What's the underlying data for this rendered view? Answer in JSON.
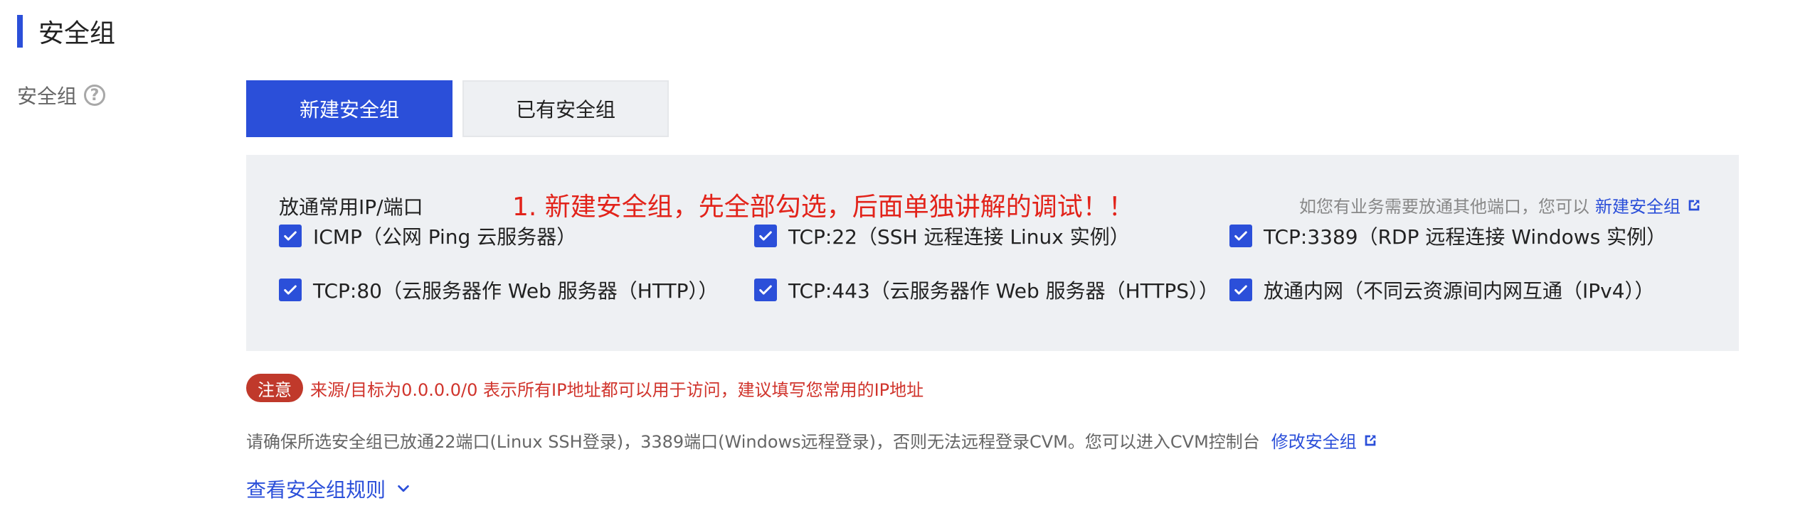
{
  "section": {
    "title": "安全组"
  },
  "field": {
    "label": "安全组",
    "help_glyph": "?"
  },
  "tabs": [
    {
      "label": "新建安全组",
      "selected": true
    },
    {
      "label": "已有安全组",
      "selected": false
    }
  ],
  "panel": {
    "title": "放通常用IP/端口",
    "annotation": "1. 新建安全组，先全部勾选，后面单独讲解的调试！！",
    "hint": "如您有业务需要放通其他端口，您可以",
    "hint_link": "新建安全组",
    "options": [
      {
        "label": "ICMP（公网 Ping 云服务器）",
        "checked": true
      },
      {
        "label": "TCP:22（SSH 远程连接 Linux 实例）",
        "checked": true
      },
      {
        "label": "TCP:3389（RDP 远程连接 Windows 实例）",
        "checked": true
      },
      {
        "label": "TCP:80（云服务器作 Web 服务器（HTTP））",
        "checked": true
      },
      {
        "label": "TCP:443（云服务器作 Web 服务器（HTTPS））",
        "checked": true
      },
      {
        "label": "放通内网（不同云资源间内网互通（IPv4））",
        "checked": true
      }
    ]
  },
  "note": {
    "badge": "注意",
    "text": "来源/目标为0.0.0.0/0 表示所有IP地址都可以用于访问，建议填写您常用的IP地址"
  },
  "info": {
    "text": "请确保所选安全组已放通22端口(Linux SSH登录)，3389端口(Windows远程登录)，否则无法远程登录CVM。您可以进入CVM控制台",
    "link": "修改安全组"
  },
  "rules_link": "查看安全组规则",
  "colors": {
    "accent": "#2b4fd9",
    "warning": "#c0392b",
    "annotation": "#e2231a"
  }
}
